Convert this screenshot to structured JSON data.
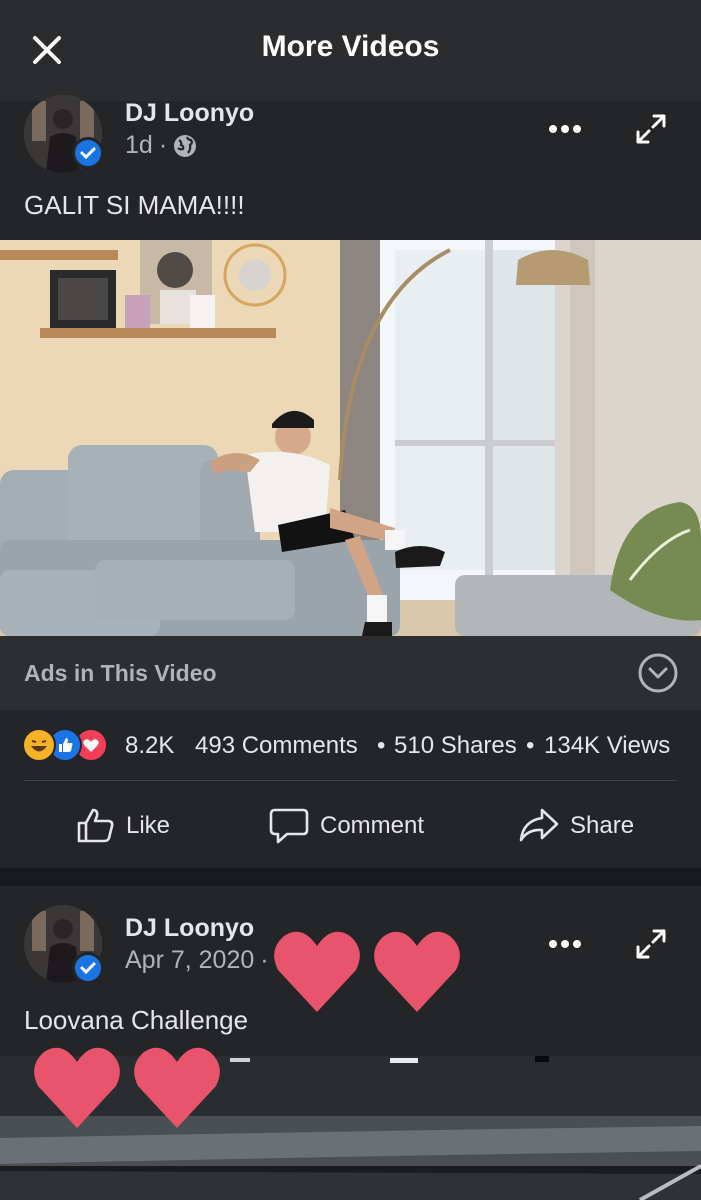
{
  "header": {
    "title": "More Videos"
  },
  "post1": {
    "author": "DJ Loonyo",
    "time": "1d",
    "separator": "·",
    "caption": "GALIT SI MAMA!!!!",
    "ads_label": "Ads in This Video",
    "reaction_count": "8.2K",
    "comments": "493 Comments",
    "shares": "510 Shares",
    "views": "134K Views",
    "dot": "•",
    "actions": {
      "like": "Like",
      "comment": "Comment",
      "share": "Share"
    }
  },
  "post2": {
    "author": "DJ Loonyo",
    "time": "Apr 7, 2020",
    "separator": "·",
    "caption": "Loovana Challenge"
  },
  "colors": {
    "accent": "#1b74e4",
    "background": "#242526",
    "heart": "#e8546b"
  },
  "icons": [
    "close-icon",
    "globe-icon",
    "more-icon",
    "expand-icon",
    "verified-icon",
    "chevron-down-icon",
    "like-icon",
    "comment-icon",
    "share-icon",
    "haha-reaction-icon",
    "like-reaction-icon",
    "love-reaction-icon",
    "heart-sticker"
  ]
}
